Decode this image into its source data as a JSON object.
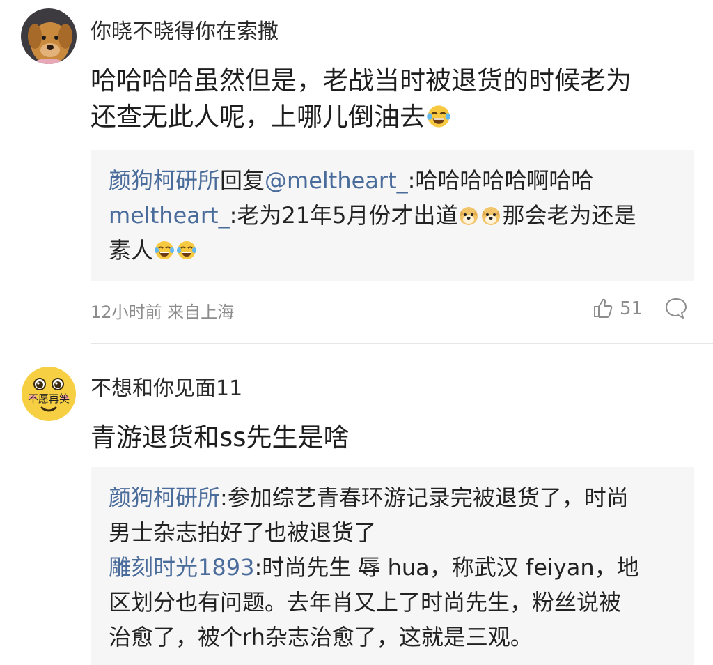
{
  "comment1": {
    "username": "你晓不晓得你在索撒",
    "body_line1": "哈哈哈哈虽然但是，老战当时被退货的时候老为",
    "body_line2": "还查无此人呢，上哪儿倒油去",
    "replies": {
      "r1_name": "颜狗柯研所",
      "r1_action": "回复",
      "r1_target": "@meltheart_",
      "r1_text": ":哈哈哈哈哈啊哈哈",
      "r2_name": "meltheart_",
      "r2_text_a": ":老为21年5月份才出道",
      "r2_text_b": "那会老为还是",
      "r2_text_c": "素人"
    },
    "meta": "12小时前 来自上海",
    "likes": "51"
  },
  "comment2": {
    "username": "不想和你见面11",
    "avatar_text": "不愿再笑",
    "body": "青游退货和ss先生是啥",
    "replies": {
      "r1_name": "颜狗柯研所",
      "r1_text_a": ":参加综艺青春环游记录完被退货了，时尚",
      "r1_text_b": "男士杂志拍好了也被退货了",
      "r2_name": "雕刻时光1893",
      "r2_text_a": ":时尚先生 辱 hua，称武汉 feiyan，地",
      "r2_text_b": "区划分也有问题。去年肖又上了时尚先生，粉丝说被",
      "r2_text_c": "治愈了，被个rh杂志治愈了，这就是三观。"
    }
  },
  "icons": {
    "like": "thumbs-up-icon",
    "comment": "comment-bubble-icon",
    "laugh_cry": "laughing-crying-emoji",
    "doge": "doge-emoji"
  },
  "colors": {
    "link_blue": "#4a6c9b",
    "reply_bg": "#f6f6f6",
    "meta_gray": "#8c8c8c"
  }
}
